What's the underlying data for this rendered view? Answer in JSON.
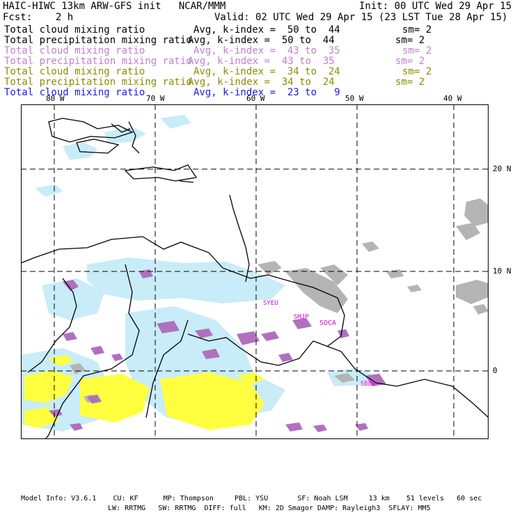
{
  "header": {
    "model_title": "HAIC-HIWC 13km ARW-GFS init   NCAR/MMM",
    "init": "Init: 00 UTC Wed 29 Apr 15",
    "fcst": "Fcst:    2 h",
    "valid": "Valid: 02 UTC Wed 29 Apr 15 (23 LST Tue 28 Apr 15)"
  },
  "legend": [
    {
      "field": "Total cloud mixing ratio",
      "kindex": "Avg, k-index =  50 to  44",
      "sm": "sm= 2",
      "color": "#000000"
    },
    {
      "field": "Total precipitation mixing ratio",
      "kindex": "Avg, k-index =  50 to  44",
      "sm": "sm= 2",
      "color": "#000000"
    },
    {
      "field": "Total cloud mixing ratio",
      "kindex": "Avg, k-index =  43 to  35",
      "sm": "sm= 2",
      "color": "#c080d0"
    },
    {
      "field": "Total precipitation mixing ratio",
      "kindex": "Avg, k-index =  43 to  35",
      "sm": "sm= 2",
      "color": "#c080d0"
    },
    {
      "field": "Total cloud mixing ratio",
      "kindex": "Avg, k-index =  34 to  24",
      "sm": "sm= 2",
      "color": "#8c8c00"
    },
    {
      "field": "Total precipitation mixing ratio",
      "kindex": "Avg, k-index =  34 to  24",
      "sm": "sm= 2",
      "color": "#8c8c00"
    },
    {
      "field": "Total cloud mixing ratio",
      "kindex": "Avg, k-index =  23 to   9",
      "sm": "",
      "color": "#1a1aee"
    }
  ],
  "map": {
    "lon_labels": [
      "80 W",
      "70 W",
      "60 W",
      "50 W",
      "40 W"
    ],
    "lat_labels": [
      "20 N",
      "10 N",
      "0"
    ],
    "stations": [
      "SYEU",
      "SMJP",
      "SOCA",
      "SBBE"
    ],
    "colors": {
      "gray": "#b4b4b4",
      "purple": "#b070c0",
      "lightblue": "#c8ecf8",
      "yellow": "#ffff40",
      "station": "#dd00dd"
    }
  },
  "footer": {
    "line1": "Model Info: V3.6.1    CU: KF      MP: Thompson     PBL: YSU       SF: Noah LSM     13 km    51 levels   60 sec",
    "line2": "LW: RRTMG   SW: RRTMG  DIFF: full   KM: 2D Smagor DAMP: Rayleigh3  SFLAY: MM5"
  }
}
